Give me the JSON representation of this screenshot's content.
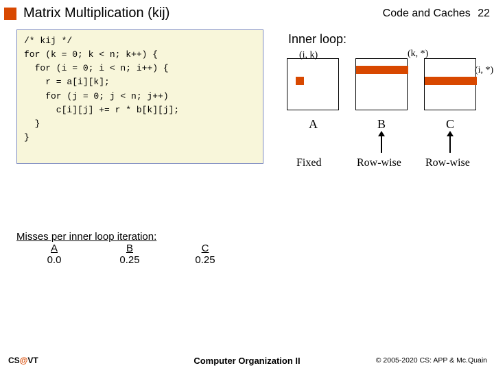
{
  "header": {
    "title": "Matrix Multiplication (kij)",
    "section": "Code and Caches",
    "page": "22"
  },
  "code": "/* kij */\nfor (k = 0; k < n; k++) {\n  for (i = 0; i < n; i++) {\n    r = a[i][k];\n    for (j = 0; j < n; j++)\n      c[i][j] += r * b[k][j];\n  }\n}",
  "inner": {
    "title": "Inner loop:",
    "A": {
      "coord": "(i, k)",
      "label": "A",
      "pattern": "Fixed"
    },
    "B": {
      "coord": "(k, *)",
      "label": "B",
      "pattern": "Row-wise"
    },
    "C": {
      "coord": "(i, *)",
      "label": "C",
      "pattern": "Row-wise"
    }
  },
  "misses": {
    "title": "Misses per inner loop iteration:",
    "cols": {
      "A": "A",
      "B": "B",
      "C": "C"
    },
    "vals": {
      "A": "0.0",
      "B": "0.25",
      "C": "0.25"
    }
  },
  "footer": {
    "left_a": "CS",
    "left_at": "@",
    "left_b": "VT",
    "center": "Computer Organization II",
    "right": "© 2005-2020 CS: APP & Mc.Quain"
  }
}
